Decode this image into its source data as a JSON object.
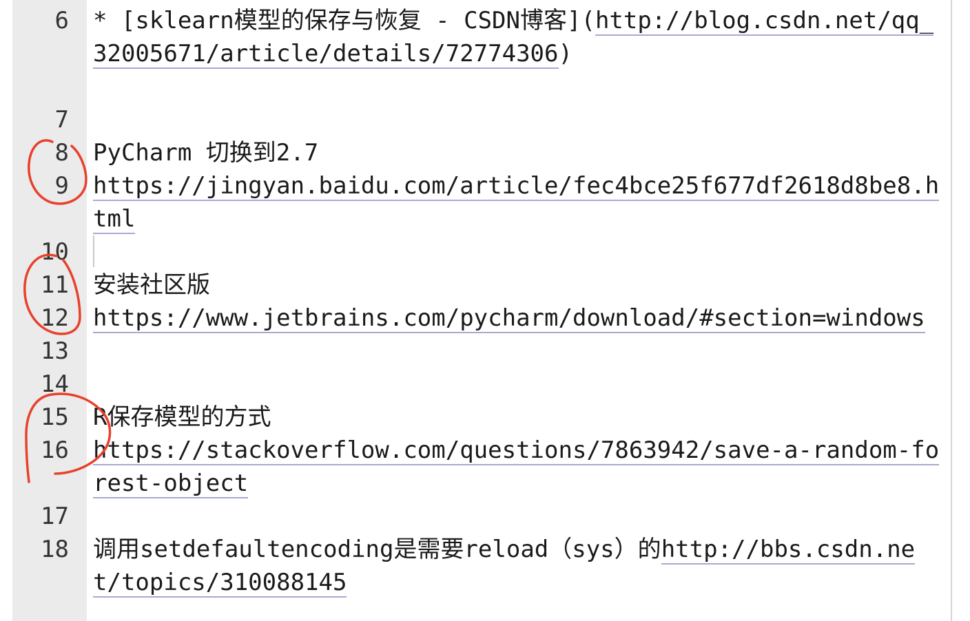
{
  "line_numbers": [
    "6",
    "7",
    "8",
    "9",
    "10",
    "11",
    "12",
    "13",
    "14",
    "15",
    "16",
    "17",
    "18"
  ],
  "lines": {
    "l6_prefix": "* [sklearn模型的保存与恢复 - CSDN博客](",
    "l6_url": "http://blog.csdn.net/qq_32005671/article/details/72774306",
    "l6_suffix": ")",
    "l8": "PyCharm 切换到2.7",
    "l9_url": "https://jingyan.baidu.com/article/fec4bce25f677df2618d8be8.html",
    "l11": "安装社区版",
    "l12_url": "https://www.jetbrains.com/pycharm/download/#section=windows",
    "l15": "R保存模型的方式",
    "l16_url": "https://stackoverflow.com/questions/7863942/save-a-random-forest-object",
    "l18_prefix": "调用setdefaultencoding是需要reload（sys）的",
    "l18_url": "http://bbs.csdn.net/topics/310088145"
  },
  "annotation_color": "#e8412c"
}
